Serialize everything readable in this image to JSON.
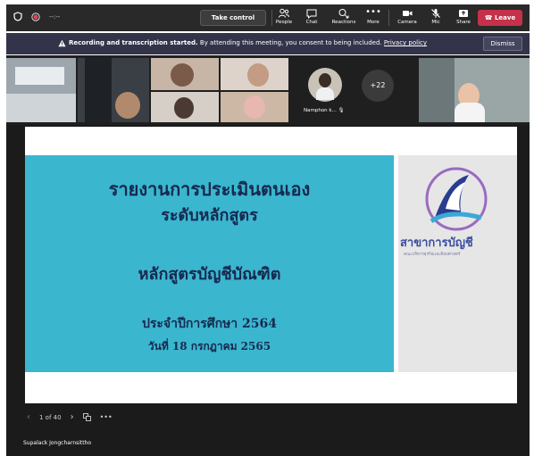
{
  "toolbar": {
    "timer": "--:--",
    "take_control": "Take control",
    "people": "People",
    "chat": "Chat",
    "reactions": "Reactions",
    "more": "More",
    "camera": "Camera",
    "mic": "Mic",
    "share": "Share",
    "leave": "Leave"
  },
  "banner": {
    "bold_text": "Recording and transcription started.",
    "text": "By attending this meeting, you consent to being included.",
    "link": "Privacy policy",
    "dismiss": "Dismiss"
  },
  "participants": {
    "name": "Namphon k...",
    "more_count": "+22"
  },
  "slide": {
    "line1": "รายงานการประเมินตนเอง",
    "line2": "ระดับหลักสูตร",
    "line3": "หลักสูตรบัญชีบัณฑิต",
    "line4": "ประจำปีการศึกษา 2564",
    "line5": "วันที่ 18 กรกฎาคม 2565",
    "logo_title": "สาขาการบัญชี",
    "logo_subtitle": "คณะบริหารธุรกิจและศิลปศาสตร์"
  },
  "pager": {
    "page": "1 of 40"
  },
  "presenter": {
    "name": "Supalack Jongcharnsittho"
  },
  "colors": {
    "toolbar_bg": "#292929",
    "banner_bg": "#33344a",
    "leave_red": "#c4314b",
    "slide_teal": "#3bb6cf",
    "slide_text": "#16294f"
  }
}
